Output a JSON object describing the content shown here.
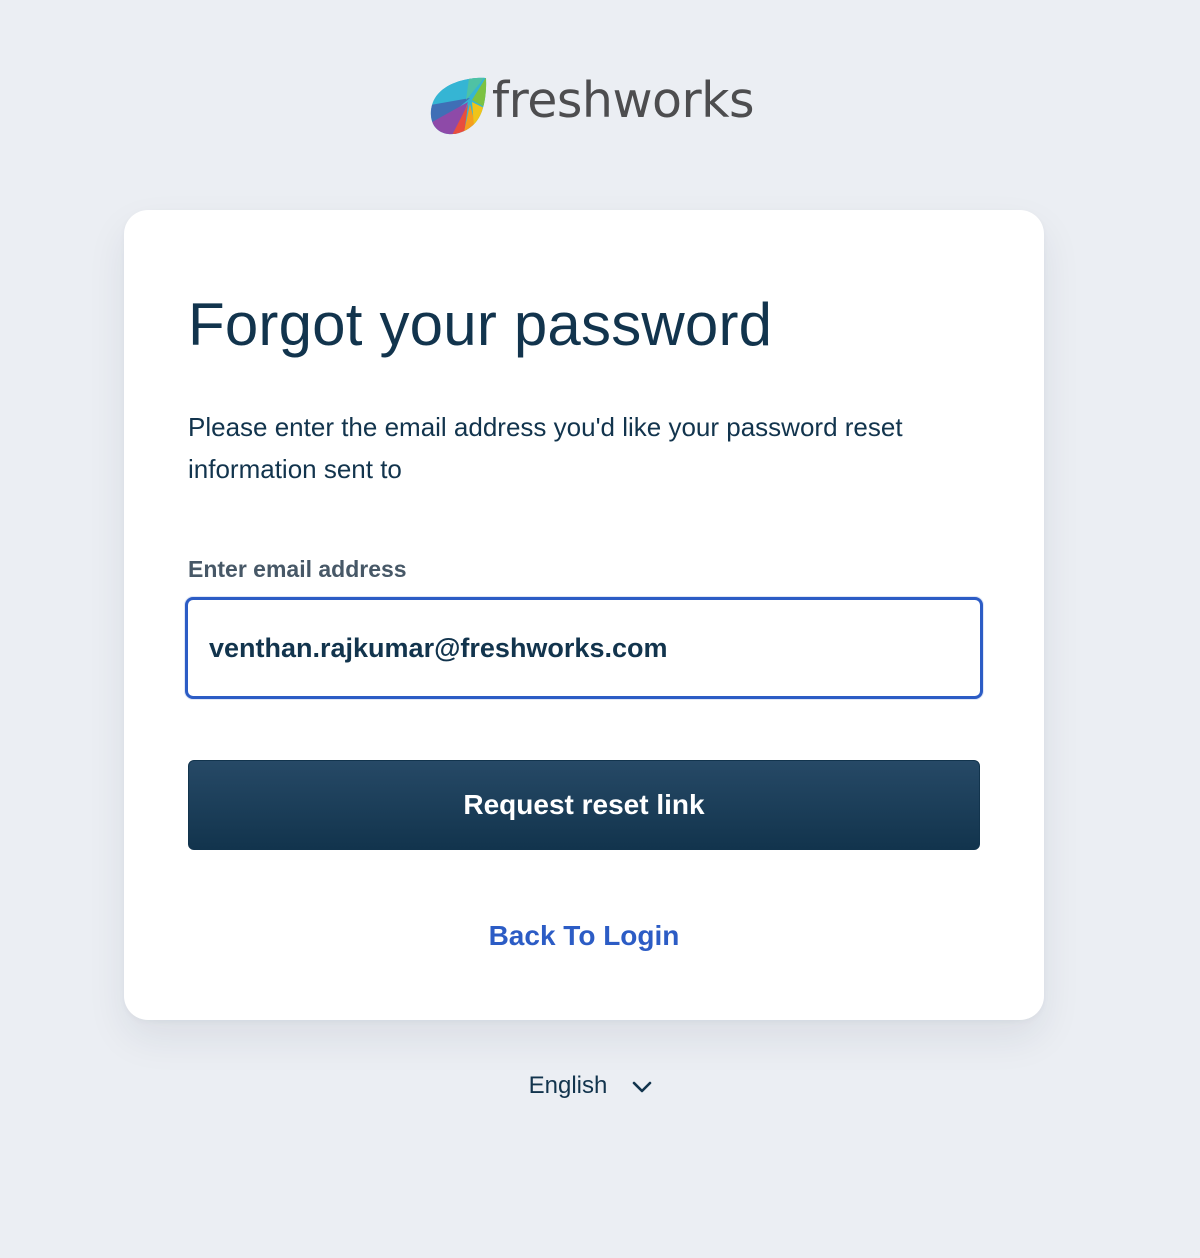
{
  "brand": {
    "name": "freshworks",
    "logo_icon": "freshworks-leaf-icon",
    "logo_colors": [
      "#f0c419",
      "#e94e3d",
      "#8e4aa8",
      "#3f6fb6",
      "#35b5d4",
      "#7cc242",
      "#f59e1e"
    ]
  },
  "card": {
    "title": "Forgot your password",
    "subtitle": "Please enter the email address you'd like your password reset information sent to",
    "email_label": "Enter email address",
    "email_value": "venthan.rajkumar@freshworks.com",
    "submit_label": "Request reset link",
    "back_link_label": "Back To Login"
  },
  "language": {
    "selected": "English",
    "icon": "chevron-down-icon"
  },
  "colors": {
    "page_background": "#ebeef3",
    "card_background": "#ffffff",
    "text_primary": "#12344d",
    "label_text": "#475867",
    "accent_blue": "#2c5cc5",
    "button_background": "#12344d"
  }
}
